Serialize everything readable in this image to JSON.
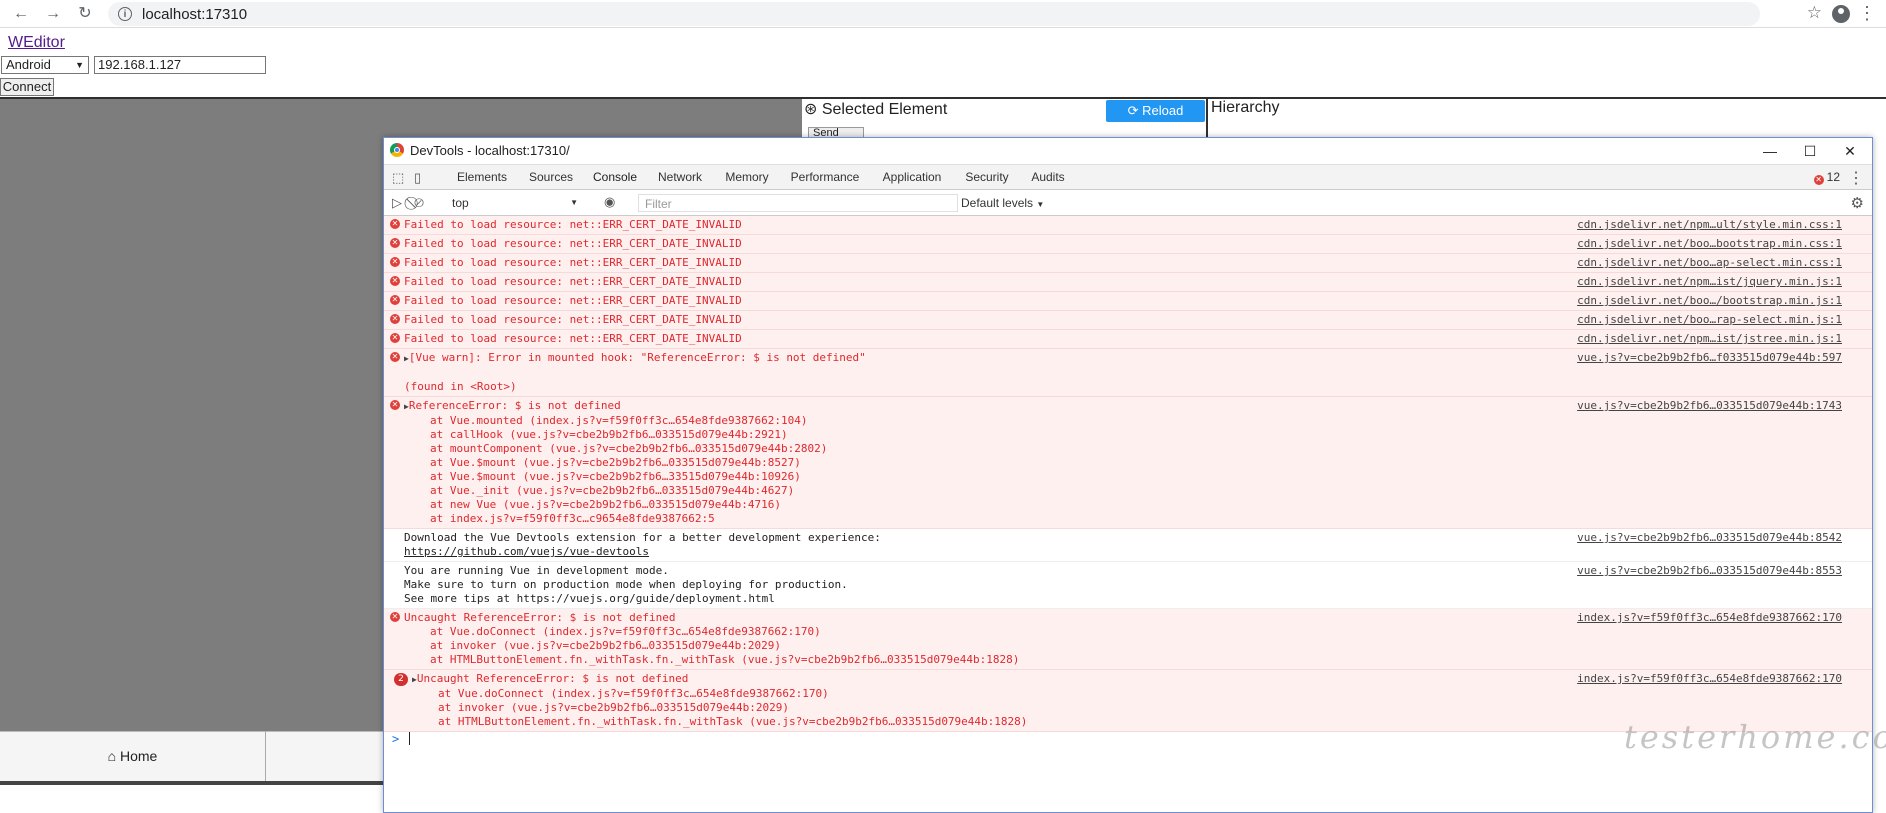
{
  "browser": {
    "url": "localhost:17310",
    "back_icon": "arrow-left-icon",
    "forward_icon": "arrow-right-icon",
    "reload_icon": "reload-icon"
  },
  "app": {
    "brand": "WEditor",
    "platform": "Android",
    "device_ip": "192.168.1.127",
    "connect_label": "Connect",
    "selected_title": "Selected Element",
    "reload_label": "Reload",
    "hierarchy_title": "Hierarchy",
    "send_keys_label": "Send Keys",
    "home_label": "Home"
  },
  "devtools": {
    "title": "DevTools - localhost:17310/",
    "tabs": [
      "Elements",
      "Sources",
      "Console",
      "Network",
      "Memory",
      "Performance",
      "Application",
      "Security",
      "Audits"
    ],
    "active_tab": "Console",
    "error_count": "12",
    "context": "top",
    "filter_placeholder": "Filter",
    "levels": "Default levels",
    "messages": [
      {
        "type": "error",
        "text": "Failed to load resource: net::ERR_CERT_DATE_INVALID",
        "source": "cdn.jsdelivr.net/npm…ult/style.min.css:1"
      },
      {
        "type": "error",
        "text": "Failed to load resource: net::ERR_CERT_DATE_INVALID",
        "source": "cdn.jsdelivr.net/boo…bootstrap.min.css:1"
      },
      {
        "type": "error",
        "text": "Failed to load resource: net::ERR_CERT_DATE_INVALID",
        "source": "cdn.jsdelivr.net/boo…ap-select.min.css:1"
      },
      {
        "type": "error",
        "text": "Failed to load resource: net::ERR_CERT_DATE_INVALID",
        "source": "cdn.jsdelivr.net/npm…ist/jquery.min.js:1"
      },
      {
        "type": "error",
        "text": "Failed to load resource: net::ERR_CERT_DATE_INVALID",
        "source": "cdn.jsdelivr.net/boo…/bootstrap.min.js:1"
      },
      {
        "type": "error",
        "text": "Failed to load resource: net::ERR_CERT_DATE_INVALID",
        "source": "cdn.jsdelivr.net/boo…rap-select.min.js:1"
      },
      {
        "type": "error",
        "text": "Failed to load resource: net::ERR_CERT_DATE_INVALID",
        "source": "cdn.jsdelivr.net/npm…ist/jstree.min.js:1"
      },
      {
        "type": "error",
        "expand": true,
        "text": "[Vue warn]: Error in mounted hook: \"ReferenceError: $ is not defined\"",
        "extra": [
          "",
          "(found in <Root>)"
        ],
        "source": "vue.js?v=cbe2b9b2fb6…f033515d079e44b:597"
      },
      {
        "type": "error",
        "expand": true,
        "text": "ReferenceError: $ is not defined",
        "stack": [
          "at Vue.mounted (index.js?v=f59f0ff3c…654e8fde9387662:104)",
          "at callHook (vue.js?v=cbe2b9b2fb6…033515d079e44b:2921)",
          "at mountComponent (vue.js?v=cbe2b9b2fb6…033515d079e44b:2802)",
          "at Vue.$mount (vue.js?v=cbe2b9b2fb6…033515d079e44b:8527)",
          "at Vue.$mount (vue.js?v=cbe2b9b2fb6…33515d079e44b:10926)",
          "at Vue._init (vue.js?v=cbe2b9b2fb6…033515d079e44b:4627)",
          "at new Vue (vue.js?v=cbe2b9b2fb6…033515d079e44b:4716)",
          "at index.js?v=f59f0ff3c…c9654e8fde9387662:5"
        ],
        "source": "vue.js?v=cbe2b9b2fb6…033515d079e44b:1743"
      },
      {
        "type": "info",
        "text": "Download the Vue Devtools extension for a better development experience:",
        "extra": [
          "https://github.com/vuejs/vue-devtools"
        ],
        "source": "vue.js?v=cbe2b9b2fb6…033515d079e44b:8542"
      },
      {
        "type": "info",
        "text": "You are running Vue in development mode.",
        "extra": [
          "Make sure to turn on production mode when deploying for production.",
          "See more tips at https://vuejs.org/guide/deployment.html"
        ],
        "source": "vue.js?v=cbe2b9b2fb6…033515d079e44b:8553"
      },
      {
        "type": "error",
        "text": "Uncaught ReferenceError: $ is not defined",
        "stack": [
          "at Vue.doConnect (index.js?v=f59f0ff3c…654e8fde9387662:170)",
          "at invoker (vue.js?v=cbe2b9b2fb6…033515d079e44b:2029)",
          "at HTMLButtonElement.fn._withTask.fn._withTask (vue.js?v=cbe2b9b2fb6…033515d079e44b:1828)"
        ],
        "source": "index.js?v=f59f0ff3c…654e8fde9387662:170"
      },
      {
        "type": "error",
        "repeat": "2",
        "expand": true,
        "text": "Uncaught ReferenceError: $ is not defined",
        "stack": [
          "at Vue.doConnect (index.js?v=f59f0ff3c…654e8fde9387662:170)",
          "at invoker (vue.js?v=cbe2b9b2fb6…033515d079e44b:2029)",
          "at HTMLButtonElement.fn._withTask.fn._withTask (vue.js?v=cbe2b9b2fb6…033515d079e44b:1828)"
        ],
        "source": "index.js?v=f59f0ff3c…654e8fde9387662:170"
      }
    ],
    "prompt": ">"
  },
  "watermark": "testerhome.com",
  "colors": {
    "accent": "#2196f3",
    "error": "#e0282d",
    "error_bg": "#fff0f0",
    "tab_active": "#1a73e8"
  }
}
